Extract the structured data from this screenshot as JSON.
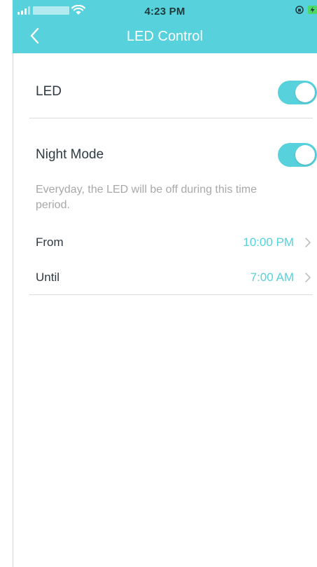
{
  "status_bar": {
    "time": "4:23 PM"
  },
  "nav": {
    "title": "LED Control"
  },
  "led": {
    "label": "LED",
    "enabled": true
  },
  "night_mode": {
    "label": "Night Mode",
    "enabled": true,
    "description": "Everyday, the LED will be off during this time period.",
    "from": {
      "label": "From",
      "value": "10:00 PM"
    },
    "until": {
      "label": "Until",
      "value": "7:00 AM"
    }
  },
  "colors": {
    "accent": "#57d1dc",
    "text_primary": "#2e3a40",
    "text_secondary": "#a8a8a8",
    "divider": "#dcdcdc"
  },
  "icons": [
    "back-chevron-icon",
    "wifi-icon",
    "signal-icon",
    "orientation-lock-icon",
    "battery-charging-icon",
    "chevron-right-icon"
  ]
}
